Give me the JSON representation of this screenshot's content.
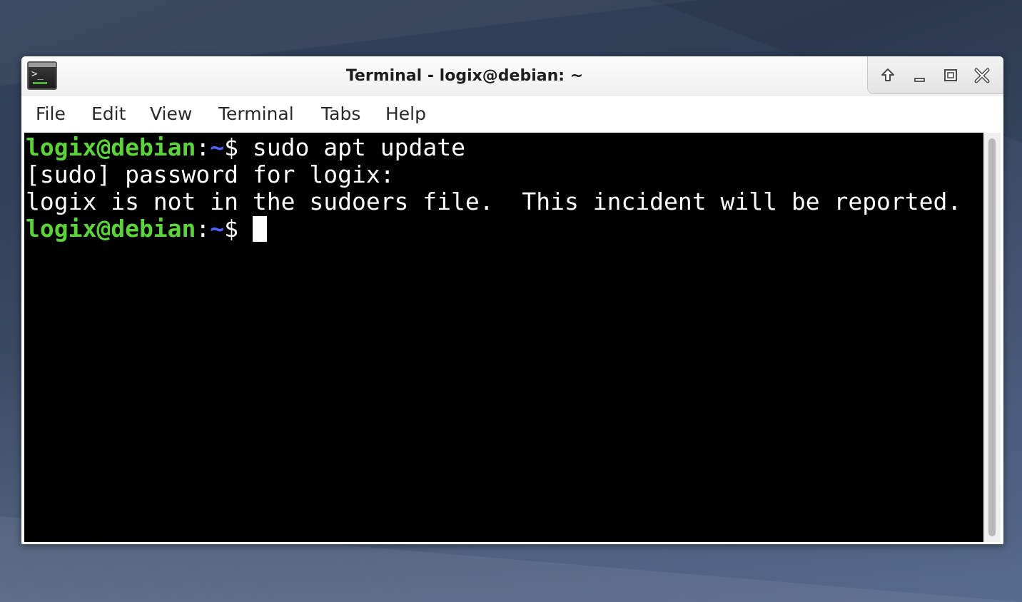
{
  "window": {
    "title": "Terminal - logix@debian: ~"
  },
  "titlebar_controls": {
    "shade": "arrow-up-icon",
    "minimize": "minimize-icon",
    "maximize": "maximize-icon",
    "close": "close-icon"
  },
  "menubar": {
    "items": [
      {
        "label": "File"
      },
      {
        "label": "Edit"
      },
      {
        "label": "View"
      },
      {
        "label": "Terminal"
      },
      {
        "label": "Tabs"
      },
      {
        "label": "Help"
      }
    ]
  },
  "terminal": {
    "colors": {
      "background": "#000000",
      "text": "#ffffff",
      "user_host": "#5cd33a",
      "path": "#4f63ff"
    },
    "lines": [
      {
        "user_host": "logix@debian",
        "colon": ":",
        "path": "~",
        "prompt": "$ ",
        "command": "sudo apt update"
      },
      {
        "text": "[sudo] password for logix:"
      },
      {
        "text": "logix is not in the sudoers file.  This incident will be reported."
      },
      {
        "user_host": "logix@debian",
        "colon": ":",
        "path": "~",
        "prompt": "$ ",
        "command": ""
      }
    ]
  }
}
